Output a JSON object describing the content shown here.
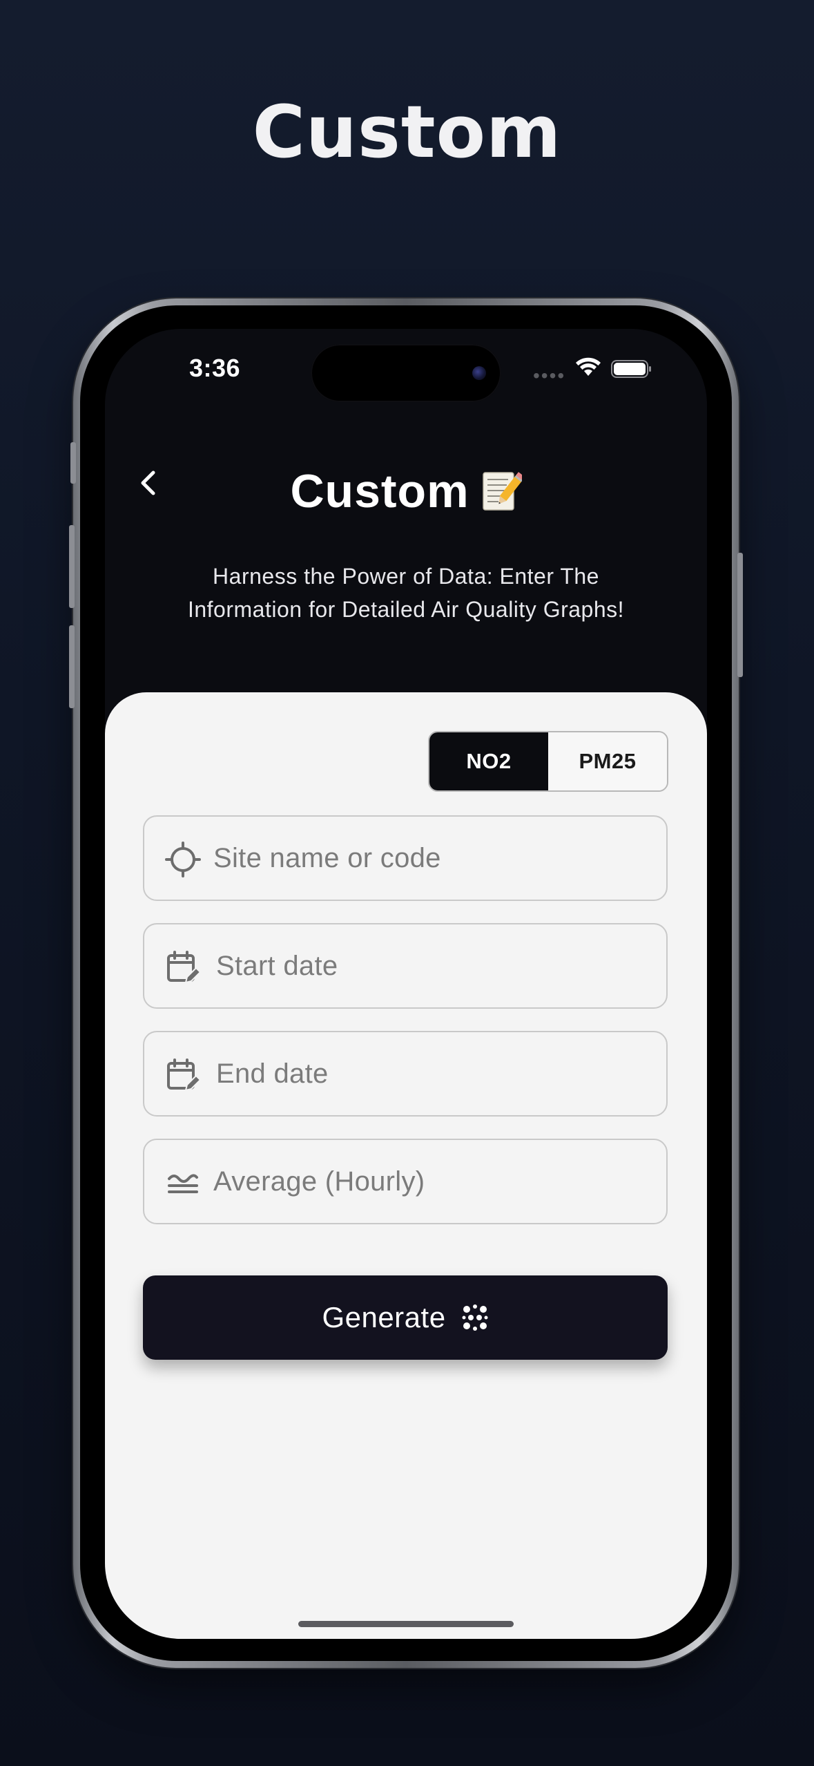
{
  "page": {
    "heading": "Custom"
  },
  "status_bar": {
    "time": "3:36",
    "dots": "••••"
  },
  "header": {
    "back_icon": "chevron-left-icon",
    "title": "Custom",
    "title_emoji": "memo-emoji",
    "subtitle_line1": "Harness the Power of Data: Enter The",
    "subtitle_line2": "Information for Detailed Air Quality Graphs!"
  },
  "pollutant_toggle": {
    "options": [
      "NO2",
      "PM25"
    ],
    "selected": "NO2"
  },
  "form": {
    "site": {
      "icon": "crosshair-icon",
      "placeholder": "Site name or code"
    },
    "start_date": {
      "icon": "calendar-edit-icon",
      "placeholder": "Start date"
    },
    "end_date": {
      "icon": "calendar-edit-icon",
      "placeholder": "End date"
    },
    "average": {
      "icon": "average-lines-icon",
      "value": "Average (Hourly)"
    }
  },
  "generate_button": {
    "label": "Generate",
    "icon": "sparkle-dots-icon"
  },
  "colors": {
    "background": "#111827",
    "screen_dark": "#0b0c11",
    "card": "#f4f4f4",
    "button": "#13121f",
    "active_segment": "#0b0c10"
  }
}
